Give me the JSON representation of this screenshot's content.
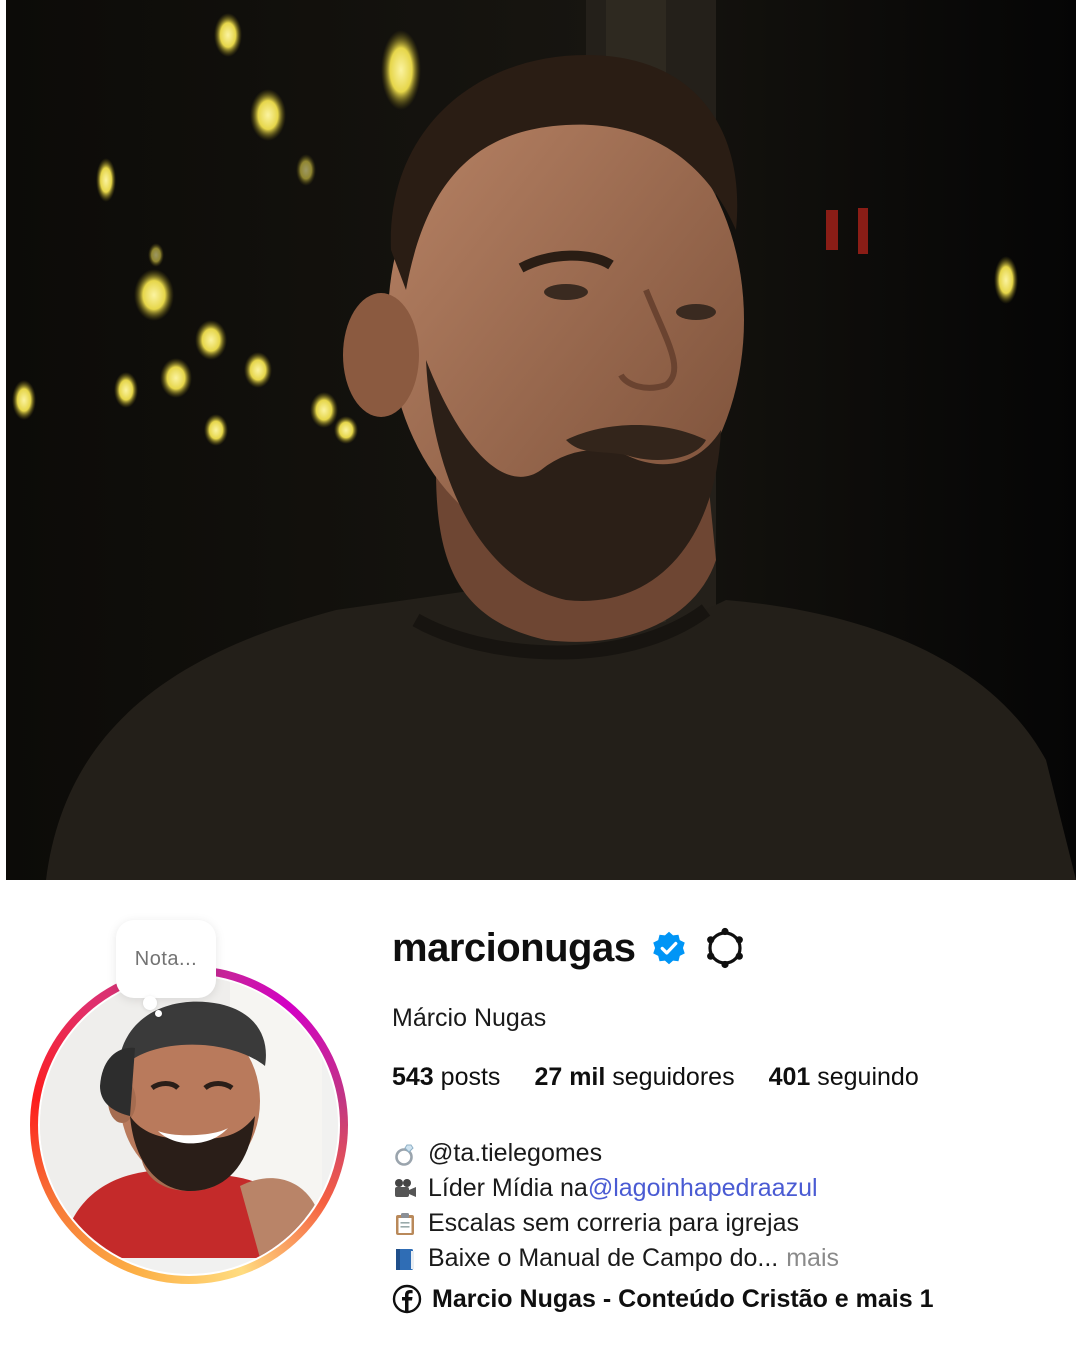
{
  "profile": {
    "username": "marcionugas",
    "full_name": "Márcio Nugas",
    "note_placeholder": "Nota...",
    "stats": {
      "posts_value": "543",
      "posts_label": "posts",
      "followers_value": "27 mil",
      "followers_label": "seguidores",
      "following_value": "401",
      "following_label": "seguindo"
    },
    "bio": {
      "line1_text": "@ta.tielegomes",
      "line1_icon": "ring-icon",
      "line2_prefix": "Líder Mídia na ",
      "line2_mention": "@lagoinhapedraazul",
      "line2_icon": "movie-camera-icon",
      "line3_text": "Escalas sem correria para igrejas",
      "line3_icon": "clipboard-icon",
      "line4_text": "Baixe o Manual de Campo do...",
      "line4_icon": "blue-book-icon",
      "more_label": "mais"
    },
    "link": {
      "icon": "facebook-icon",
      "text": "Marcio Nugas - Conteúdo Cristão e mais 1"
    }
  },
  "colors": {
    "mention": "#4a5bd3",
    "verified": "#0095f6",
    "muted": "#737373"
  }
}
